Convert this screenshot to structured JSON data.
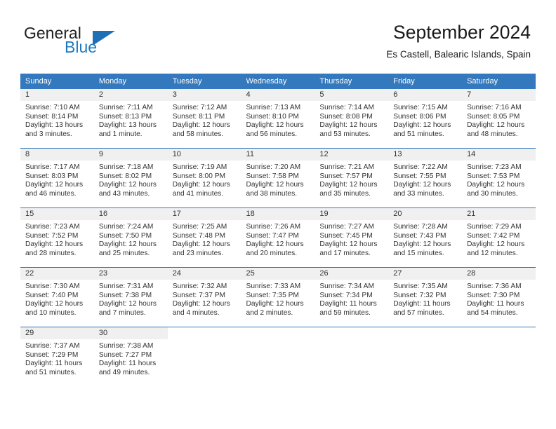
{
  "brand": {
    "name_part1": "General",
    "name_part2": "Blue",
    "logo_icon": "triangle-flag-icon",
    "accent_color": "#1f6fb4"
  },
  "header": {
    "month_title": "September 2024",
    "location": "Es Castell, Balearic Islands, Spain"
  },
  "calendar": {
    "header_bg": "#3478bd",
    "weekdays": [
      "Sunday",
      "Monday",
      "Tuesday",
      "Wednesday",
      "Thursday",
      "Friday",
      "Saturday"
    ],
    "weeks": [
      [
        {
          "day": "1",
          "sunrise": "Sunrise: 7:10 AM",
          "sunset": "Sunset: 8:14 PM",
          "daylight_line1": "Daylight: 13 hours",
          "daylight_line2": "and 3 minutes."
        },
        {
          "day": "2",
          "sunrise": "Sunrise: 7:11 AM",
          "sunset": "Sunset: 8:13 PM",
          "daylight_line1": "Daylight: 13 hours",
          "daylight_line2": "and 1 minute."
        },
        {
          "day": "3",
          "sunrise": "Sunrise: 7:12 AM",
          "sunset": "Sunset: 8:11 PM",
          "daylight_line1": "Daylight: 12 hours",
          "daylight_line2": "and 58 minutes."
        },
        {
          "day": "4",
          "sunrise": "Sunrise: 7:13 AM",
          "sunset": "Sunset: 8:10 PM",
          "daylight_line1": "Daylight: 12 hours",
          "daylight_line2": "and 56 minutes."
        },
        {
          "day": "5",
          "sunrise": "Sunrise: 7:14 AM",
          "sunset": "Sunset: 8:08 PM",
          "daylight_line1": "Daylight: 12 hours",
          "daylight_line2": "and 53 minutes."
        },
        {
          "day": "6",
          "sunrise": "Sunrise: 7:15 AM",
          "sunset": "Sunset: 8:06 PM",
          "daylight_line1": "Daylight: 12 hours",
          "daylight_line2": "and 51 minutes."
        },
        {
          "day": "7",
          "sunrise": "Sunrise: 7:16 AM",
          "sunset": "Sunset: 8:05 PM",
          "daylight_line1": "Daylight: 12 hours",
          "daylight_line2": "and 48 minutes."
        }
      ],
      [
        {
          "day": "8",
          "sunrise": "Sunrise: 7:17 AM",
          "sunset": "Sunset: 8:03 PM",
          "daylight_line1": "Daylight: 12 hours",
          "daylight_line2": "and 46 minutes."
        },
        {
          "day": "9",
          "sunrise": "Sunrise: 7:18 AM",
          "sunset": "Sunset: 8:02 PM",
          "daylight_line1": "Daylight: 12 hours",
          "daylight_line2": "and 43 minutes."
        },
        {
          "day": "10",
          "sunrise": "Sunrise: 7:19 AM",
          "sunset": "Sunset: 8:00 PM",
          "daylight_line1": "Daylight: 12 hours",
          "daylight_line2": "and 41 minutes."
        },
        {
          "day": "11",
          "sunrise": "Sunrise: 7:20 AM",
          "sunset": "Sunset: 7:58 PM",
          "daylight_line1": "Daylight: 12 hours",
          "daylight_line2": "and 38 minutes."
        },
        {
          "day": "12",
          "sunrise": "Sunrise: 7:21 AM",
          "sunset": "Sunset: 7:57 PM",
          "daylight_line1": "Daylight: 12 hours",
          "daylight_line2": "and 35 minutes."
        },
        {
          "day": "13",
          "sunrise": "Sunrise: 7:22 AM",
          "sunset": "Sunset: 7:55 PM",
          "daylight_line1": "Daylight: 12 hours",
          "daylight_line2": "and 33 minutes."
        },
        {
          "day": "14",
          "sunrise": "Sunrise: 7:23 AM",
          "sunset": "Sunset: 7:53 PM",
          "daylight_line1": "Daylight: 12 hours",
          "daylight_line2": "and 30 minutes."
        }
      ],
      [
        {
          "day": "15",
          "sunrise": "Sunrise: 7:23 AM",
          "sunset": "Sunset: 7:52 PM",
          "daylight_line1": "Daylight: 12 hours",
          "daylight_line2": "and 28 minutes."
        },
        {
          "day": "16",
          "sunrise": "Sunrise: 7:24 AM",
          "sunset": "Sunset: 7:50 PM",
          "daylight_line1": "Daylight: 12 hours",
          "daylight_line2": "and 25 minutes."
        },
        {
          "day": "17",
          "sunrise": "Sunrise: 7:25 AM",
          "sunset": "Sunset: 7:48 PM",
          "daylight_line1": "Daylight: 12 hours",
          "daylight_line2": "and 23 minutes."
        },
        {
          "day": "18",
          "sunrise": "Sunrise: 7:26 AM",
          "sunset": "Sunset: 7:47 PM",
          "daylight_line1": "Daylight: 12 hours",
          "daylight_line2": "and 20 minutes."
        },
        {
          "day": "19",
          "sunrise": "Sunrise: 7:27 AM",
          "sunset": "Sunset: 7:45 PM",
          "daylight_line1": "Daylight: 12 hours",
          "daylight_line2": "and 17 minutes."
        },
        {
          "day": "20",
          "sunrise": "Sunrise: 7:28 AM",
          "sunset": "Sunset: 7:43 PM",
          "daylight_line1": "Daylight: 12 hours",
          "daylight_line2": "and 15 minutes."
        },
        {
          "day": "21",
          "sunrise": "Sunrise: 7:29 AM",
          "sunset": "Sunset: 7:42 PM",
          "daylight_line1": "Daylight: 12 hours",
          "daylight_line2": "and 12 minutes."
        }
      ],
      [
        {
          "day": "22",
          "sunrise": "Sunrise: 7:30 AM",
          "sunset": "Sunset: 7:40 PM",
          "daylight_line1": "Daylight: 12 hours",
          "daylight_line2": "and 10 minutes."
        },
        {
          "day": "23",
          "sunrise": "Sunrise: 7:31 AM",
          "sunset": "Sunset: 7:38 PM",
          "daylight_line1": "Daylight: 12 hours",
          "daylight_line2": "and 7 minutes."
        },
        {
          "day": "24",
          "sunrise": "Sunrise: 7:32 AM",
          "sunset": "Sunset: 7:37 PM",
          "daylight_line1": "Daylight: 12 hours",
          "daylight_line2": "and 4 minutes."
        },
        {
          "day": "25",
          "sunrise": "Sunrise: 7:33 AM",
          "sunset": "Sunset: 7:35 PM",
          "daylight_line1": "Daylight: 12 hours",
          "daylight_line2": "and 2 minutes."
        },
        {
          "day": "26",
          "sunrise": "Sunrise: 7:34 AM",
          "sunset": "Sunset: 7:34 PM",
          "daylight_line1": "Daylight: 11 hours",
          "daylight_line2": "and 59 minutes."
        },
        {
          "day": "27",
          "sunrise": "Sunrise: 7:35 AM",
          "sunset": "Sunset: 7:32 PM",
          "daylight_line1": "Daylight: 11 hours",
          "daylight_line2": "and 57 minutes."
        },
        {
          "day": "28",
          "sunrise": "Sunrise: 7:36 AM",
          "sunset": "Sunset: 7:30 PM",
          "daylight_line1": "Daylight: 11 hours",
          "daylight_line2": "and 54 minutes."
        }
      ],
      [
        {
          "day": "29",
          "sunrise": "Sunrise: 7:37 AM",
          "sunset": "Sunset: 7:29 PM",
          "daylight_line1": "Daylight: 11 hours",
          "daylight_line2": "and 51 minutes."
        },
        {
          "day": "30",
          "sunrise": "Sunrise: 7:38 AM",
          "sunset": "Sunset: 7:27 PM",
          "daylight_line1": "Daylight: 11 hours",
          "daylight_line2": "and 49 minutes."
        },
        {
          "day": "",
          "sunrise": "",
          "sunset": "",
          "daylight_line1": "",
          "daylight_line2": ""
        },
        {
          "day": "",
          "sunrise": "",
          "sunset": "",
          "daylight_line1": "",
          "daylight_line2": ""
        },
        {
          "day": "",
          "sunrise": "",
          "sunset": "",
          "daylight_line1": "",
          "daylight_line2": ""
        },
        {
          "day": "",
          "sunrise": "",
          "sunset": "",
          "daylight_line1": "",
          "daylight_line2": ""
        },
        {
          "day": "",
          "sunrise": "",
          "sunset": "",
          "daylight_line1": "",
          "daylight_line2": ""
        }
      ]
    ]
  }
}
